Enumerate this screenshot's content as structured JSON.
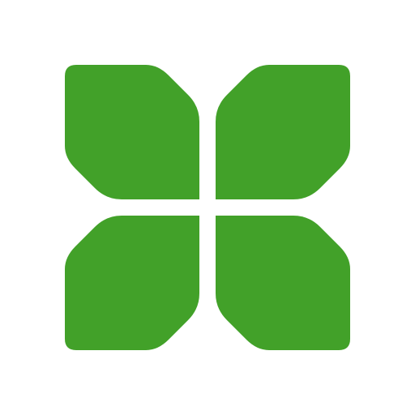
{
  "logo": {
    "icon": "four-petal-clover-logo-icon",
    "color": "#42A129",
    "background": "#FFFFFF"
  }
}
